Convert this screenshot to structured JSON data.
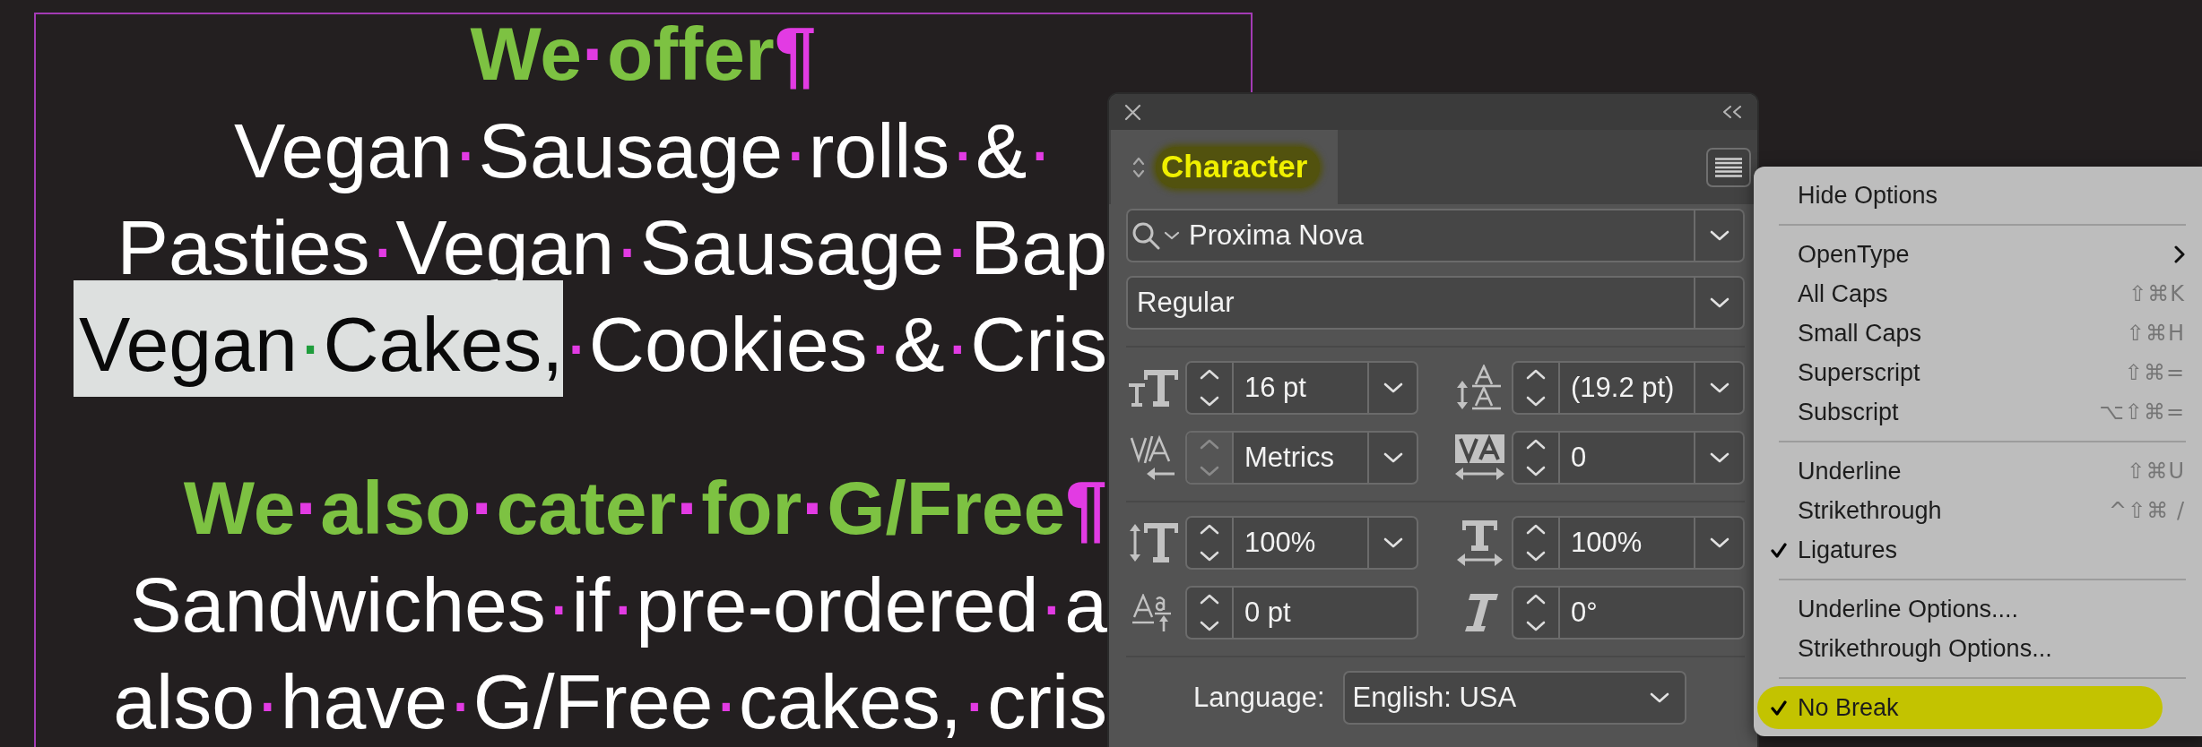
{
  "canvas": {
    "paragraphs": [
      {
        "kind": "heading",
        "lines": [
          {
            "cut_off": false,
            "parts": [
              {
                "text": "We·offer¶",
                "selected": false
              }
            ]
          }
        ]
      },
      {
        "kind": "body",
        "lines": [
          {
            "cut_off": false,
            "parts": [
              {
                "text": "Vegan·Sausage·rolls·&·",
                "selected": false
              }
            ]
          },
          {
            "cut_off": true,
            "parts": [
              {
                "text": "Pasties·Vegan·Sausage·Bap",
                "selected": false
              }
            ]
          },
          {
            "cut_off": true,
            "parts": [
              {
                "text": "Vegan·Cakes,",
                "selected": true
              },
              {
                "text": "·Cookies·&·Cris",
                "selected": false
              }
            ]
          }
        ]
      },
      {
        "kind": "heading",
        "lines": [
          {
            "cut_off": true,
            "parts": [
              {
                "text": "We·also·cater·for·G/Free¶",
                "selected": false
              }
            ]
          }
        ]
      },
      {
        "kind": "body",
        "lines": [
          {
            "cut_off": true,
            "parts": [
              {
                "text": "Sandwiches·if·pre-ordered·a",
                "selected": false
              }
            ]
          },
          {
            "cut_off": true,
            "parts": [
              {
                "text": "also·have·G/Free·cakes,·cris",
                "selected": false
              }
            ]
          }
        ]
      }
    ]
  },
  "panel": {
    "tab": {
      "label": "Character",
      "selected": true,
      "highlighted": true
    },
    "font_family": {
      "value": "Proxima Nova"
    },
    "font_style": {
      "value": "Regular"
    },
    "groups": [
      {
        "fields": [
          {
            "kind": "combo",
            "value": "16 pt",
            "stepper_disabled": false
          },
          {
            "kind": "combo",
            "value": "(19.2 pt)",
            "stepper_disabled": false
          },
          {
            "kind": "combo",
            "value": "Metrics",
            "stepper_disabled": true
          },
          {
            "kind": "combo",
            "value": "0",
            "stepper_disabled": false
          }
        ]
      },
      {
        "fields": [
          {
            "kind": "combo",
            "value": "100%",
            "stepper_disabled": false
          },
          {
            "kind": "combo",
            "value": "100%",
            "stepper_disabled": false
          },
          {
            "kind": "spin",
            "value": "0 pt",
            "stepper_disabled": false
          },
          {
            "kind": "spin",
            "value": "0°",
            "stepper_disabled": false
          }
        ]
      }
    ],
    "language": {
      "label": "Language:",
      "value": "English: USA"
    }
  },
  "menu": {
    "sections": [
      {
        "items": [
          {
            "kind": "command",
            "label": "Hide Options",
            "checked": false,
            "highlighted": false
          }
        ]
      },
      {
        "items": [
          {
            "kind": "submenu",
            "label": "OpenType",
            "checked": false,
            "highlighted": false
          },
          {
            "kind": "command",
            "label": "All Caps",
            "shortcut": "⇧⌘K",
            "checked": false,
            "highlighted": false
          },
          {
            "kind": "command",
            "label": "Small Caps",
            "shortcut": "⇧⌘H",
            "checked": false,
            "highlighted": false
          },
          {
            "kind": "command",
            "label": "Superscript",
            "shortcut": "⇧⌘=",
            "checked": false,
            "highlighted": false
          },
          {
            "kind": "command",
            "label": "Subscript",
            "shortcut": "⌥⇧⌘=",
            "checked": false,
            "highlighted": false
          }
        ]
      },
      {
        "items": [
          {
            "kind": "command",
            "label": "Underline",
            "shortcut": "⇧⌘U",
            "checked": false,
            "highlighted": false
          },
          {
            "kind": "command",
            "label": "Strikethrough",
            "shortcut": "^⇧⌘ /",
            "checked": false,
            "highlighted": false
          },
          {
            "kind": "command",
            "label": "Ligatures",
            "checked": true,
            "highlighted": false
          }
        ]
      },
      {
        "items": [
          {
            "kind": "command",
            "label": "Underline Options....",
            "checked": false,
            "highlighted": false
          },
          {
            "kind": "command",
            "label": "Strikethrough Options...",
            "checked": false,
            "highlighted": false
          }
        ]
      },
      {
        "items": [
          {
            "kind": "command",
            "label": "No Break",
            "checked": true,
            "highlighted": true
          }
        ]
      }
    ]
  }
}
